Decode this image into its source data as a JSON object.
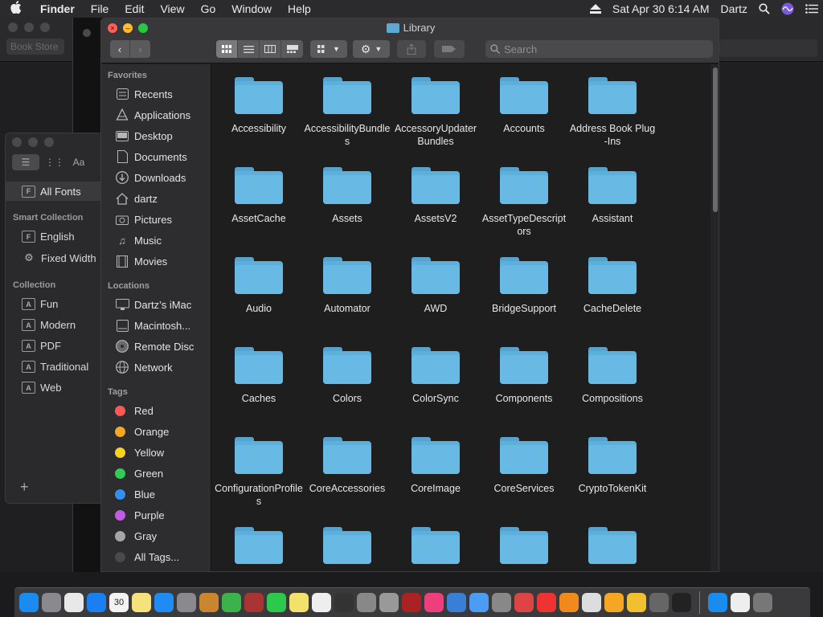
{
  "menubar": {
    "app_name": "Finder",
    "items": [
      "File",
      "Edit",
      "View",
      "Go",
      "Window",
      "Help"
    ],
    "clock": "Sat Apr 30  6:14 AM",
    "user": "Dartz"
  },
  "background": {
    "bookstore_search": "Book Store"
  },
  "fonts_window": {
    "all_fonts": "All Fonts",
    "smart_collection_header": "Smart Collection",
    "smart_items": [
      "English",
      "Fixed Width"
    ],
    "collection_header": "Collection",
    "collection_items": [
      "Fun",
      "Modern",
      "PDF",
      "Traditional",
      "Web"
    ],
    "aa_label": "Aa",
    "plus": "+"
  },
  "finder": {
    "title": "Library",
    "search_placeholder": "Search",
    "sidebar": {
      "favorites_header": "Favorites",
      "favorites": [
        {
          "label": "Recents",
          "icon": "recents-icon"
        },
        {
          "label": "Applications",
          "icon": "applications-icon"
        },
        {
          "label": "Desktop",
          "icon": "desktop-icon"
        },
        {
          "label": "Documents",
          "icon": "documents-icon"
        },
        {
          "label": "Downloads",
          "icon": "downloads-icon"
        },
        {
          "label": "dartz",
          "icon": "home-icon"
        },
        {
          "label": "Pictures",
          "icon": "pictures-icon"
        },
        {
          "label": "Music",
          "icon": "music-icon"
        },
        {
          "label": "Movies",
          "icon": "movies-icon"
        }
      ],
      "locations_header": "Locations",
      "locations": [
        {
          "label": "Dartz’s iMac",
          "icon": "imac-icon"
        },
        {
          "label": "Macintosh...",
          "icon": "hard-disk-icon"
        },
        {
          "label": "Remote Disc",
          "icon": "disc-icon"
        },
        {
          "label": "Network",
          "icon": "network-icon"
        }
      ],
      "tags_header": "Tags",
      "tags": [
        {
          "label": "Red",
          "color": "#ff5a52"
        },
        {
          "label": "Orange",
          "color": "#f5a623"
        },
        {
          "label": "Yellow",
          "color": "#f4d41f"
        },
        {
          "label": "Green",
          "color": "#2fcc58"
        },
        {
          "label": "Blue",
          "color": "#2f8ff2"
        },
        {
          "label": "Purple",
          "color": "#c25ce6"
        },
        {
          "label": "Gray",
          "color": "#a5a5a8"
        },
        {
          "label": "All Tags...",
          "color": "#4a4a4d"
        }
      ]
    },
    "folders": [
      "Accessibility",
      "AccessibilityBundles",
      "AccessoryUpdaterBundles",
      "Accounts",
      "Address Book Plug-Ins",
      "AssetCache",
      "Assets",
      "AssetsV2",
      "AssetTypeDescriptors",
      "Assistant",
      "Audio",
      "Automator",
      "AWD",
      "BridgeSupport",
      "CacheDelete",
      "Caches",
      "Colors",
      "ColorSync",
      "Components",
      "Compositions",
      "ConfigurationProfiles",
      "CoreAccessories",
      "CoreImage",
      "CoreServices",
      "CryptoTokenKit",
      "",
      "",
      "",
      "",
      ""
    ]
  },
  "dock": {
    "apps": [
      "finder",
      "launchpad",
      "chrome",
      "safari",
      "calendar",
      "notes",
      "app-store",
      "system-preferences",
      "books",
      "numbers",
      "dictionary",
      "facetime",
      "stickies",
      "textedit",
      "activity-monitor",
      "script-editor",
      "screenshot",
      "photo-booth",
      "itunes",
      "preview",
      "messages",
      "automator",
      "tweak",
      "news",
      "ibooks",
      "file",
      "home",
      "photos",
      "grapher",
      "terminal",
      "appstore-download",
      "document",
      "trash"
    ],
    "calendar_day": "30"
  },
  "colors": {
    "folder_blue": "#5dafdc",
    "close_red": "#ff5f57",
    "minimize_yellow": "#febc2e",
    "zoom_green": "#28c840"
  }
}
